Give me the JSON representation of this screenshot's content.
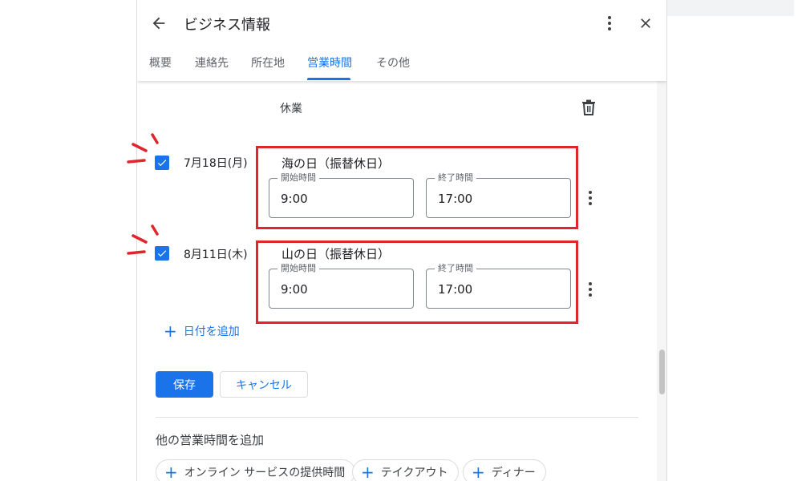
{
  "header": {
    "title": "ビジネス情報",
    "tabs": [
      {
        "label": "概要",
        "active": false
      },
      {
        "label": "連絡先",
        "active": false
      },
      {
        "label": "所在地",
        "active": false
      },
      {
        "label": "営業時間",
        "active": true
      },
      {
        "label": "その他",
        "active": false
      }
    ]
  },
  "special_hours": {
    "closed_label": "休業",
    "entries": [
      {
        "checked": true,
        "date": "7月18日(月)",
        "holiday": "海の日（振替休日）",
        "open_label": "開始時間",
        "open_value": "9:00",
        "close_label": "終了時間",
        "close_value": "17:00"
      },
      {
        "checked": true,
        "date": "8月11日(木)",
        "holiday": "山の日（振替休日）",
        "open_label": "開始時間",
        "open_value": "9:00",
        "close_label": "終了時間",
        "close_value": "17:00"
      }
    ],
    "add_date_label": "日付を追加"
  },
  "actions": {
    "save_label": "保存",
    "cancel_label": "キャンセル"
  },
  "other_hours": {
    "title": "他の営業時間を追加",
    "chips": [
      "オンライン サービスの提供時間",
      "テイクアウト",
      "ディナー"
    ]
  },
  "colors": {
    "accent": "#1a73e8",
    "highlight": "#e0252b"
  }
}
